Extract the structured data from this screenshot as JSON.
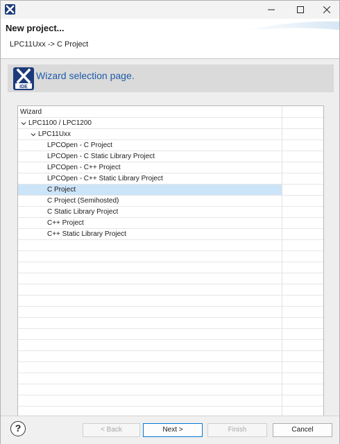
{
  "window": {
    "app_icon": "x-app-icon",
    "title_bar_buttons": [
      "minimize-icon",
      "maximize-icon",
      "close-icon"
    ]
  },
  "header": {
    "title": "New project...",
    "subtitle": "LPC11Uxx -> C Project"
  },
  "page": {
    "logo_text": "IDE",
    "title": "Wizard selection page."
  },
  "tree": {
    "column_header": "Wizard",
    "items": [
      {
        "label": "LPC1100 / LPC1200",
        "level": 0,
        "expanded": true
      },
      {
        "label": "LPC11Uxx",
        "level": 1,
        "expanded": true
      },
      {
        "label": "LPCOpen - C Project",
        "level": 2
      },
      {
        "label": "LPCOpen - C Static Library Project",
        "level": 2
      },
      {
        "label": "LPCOpen - C++ Project",
        "level": 2
      },
      {
        "label": "LPCOpen - C++ Static Library Project",
        "level": 2
      },
      {
        "label": "C Project",
        "level": 2,
        "selected": true
      },
      {
        "label": "C Project (Semihosted)",
        "level": 2
      },
      {
        "label": "C Static Library Project",
        "level": 2
      },
      {
        "label": "C++ Project",
        "level": 2
      },
      {
        "label": "C++ Static Library Project",
        "level": 2
      }
    ]
  },
  "footer": {
    "help_label": "?",
    "back_label": "< Back",
    "next_label": "Next >",
    "finish_label": "Finish",
    "cancel_label": "Cancel"
  },
  "colors": {
    "page_title": "#1e5ba8",
    "selection": "#cce4f7",
    "default_button_border": "#0078d4",
    "app_icon_bg": "#1c3b7a"
  }
}
